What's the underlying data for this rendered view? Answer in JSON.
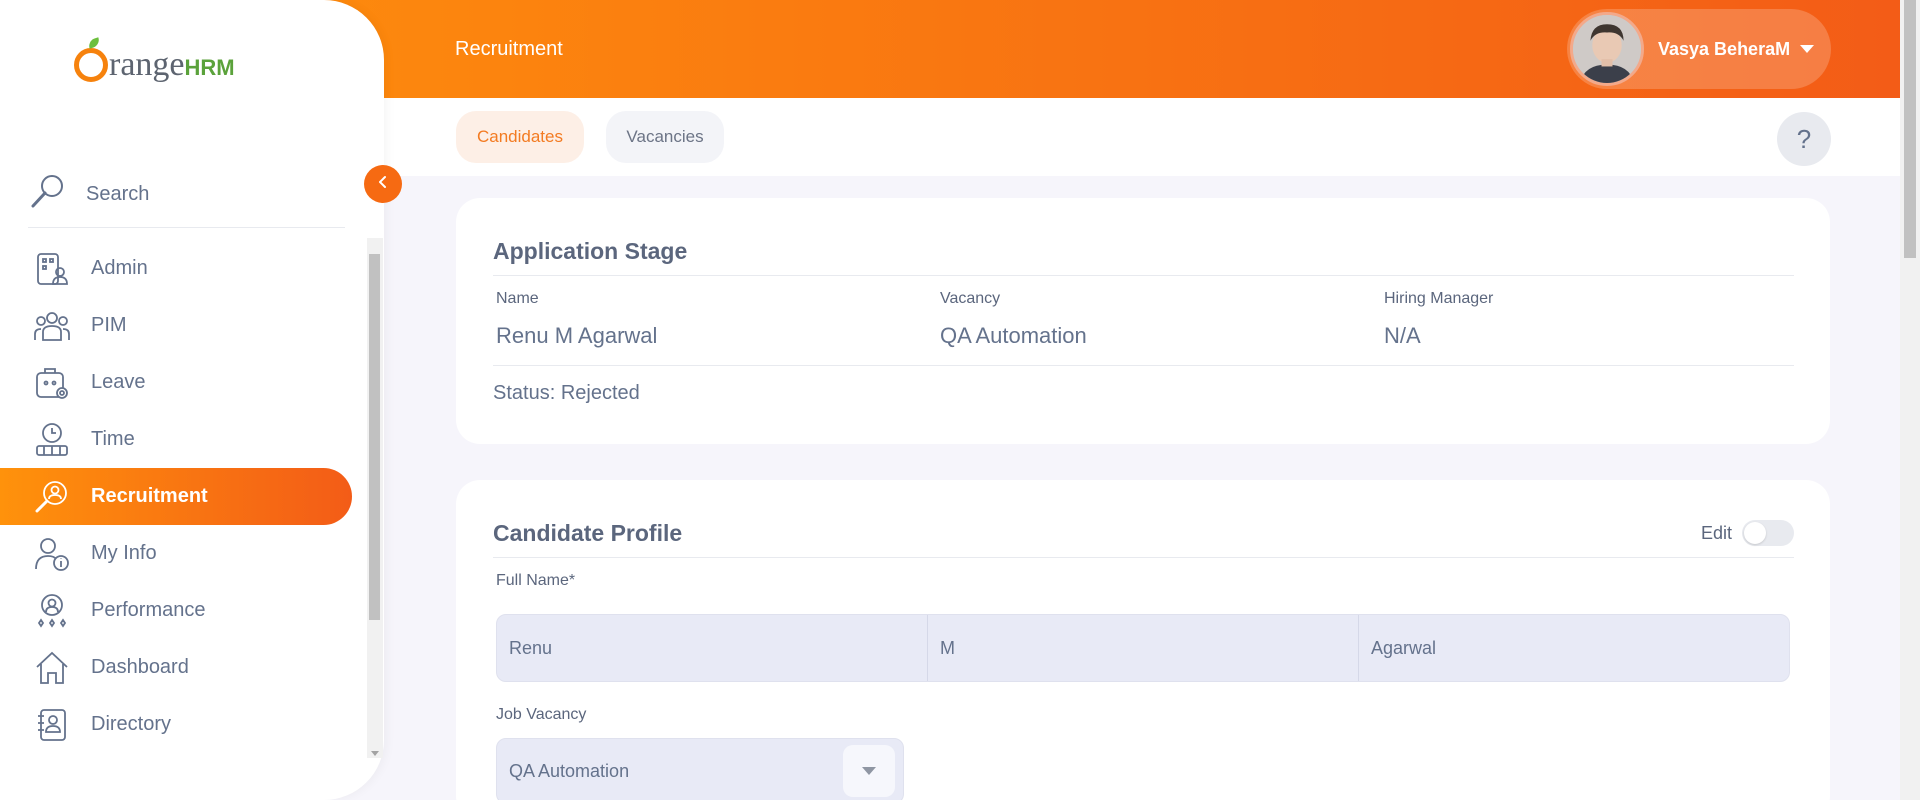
{
  "header": {
    "module_title": "Recruitment",
    "user_name": "Vasya BeheraM"
  },
  "tabs": [
    {
      "label": "Candidates",
      "active": true
    },
    {
      "label": "Vacancies",
      "active": false
    }
  ],
  "help": {
    "label": "?"
  },
  "sidebar": {
    "logo_prefix": "range",
    "logo_suffix": "HRM",
    "search_label": "Search",
    "items": [
      {
        "label": "Admin",
        "icon": "admin-icon"
      },
      {
        "label": "PIM",
        "icon": "pim-icon"
      },
      {
        "label": "Leave",
        "icon": "leave-icon"
      },
      {
        "label": "Time",
        "icon": "time-icon"
      },
      {
        "label": "Recruitment",
        "icon": "recruitment-icon",
        "active": true
      },
      {
        "label": "My Info",
        "icon": "my-info-icon"
      },
      {
        "label": "Performance",
        "icon": "performance-icon"
      },
      {
        "label": "Dashboard",
        "icon": "dashboard-icon"
      },
      {
        "label": "Directory",
        "icon": "directory-icon"
      }
    ]
  },
  "application_stage": {
    "title": "Application Stage",
    "name_label": "Name",
    "name_value": "Renu M Agarwal",
    "vacancy_label": "Vacancy",
    "vacancy_value": "QA Automation",
    "hiring_manager_label": "Hiring Manager",
    "hiring_manager_value": "N/A",
    "status_text": "Status: Rejected"
  },
  "candidate_profile": {
    "title": "Candidate Profile",
    "edit_label": "Edit",
    "edit_enabled": false,
    "full_name_label": "Full Name*",
    "first_name": "Renu",
    "middle_name": "M",
    "last_name": "Agarwal",
    "job_vacancy_label": "Job Vacancy",
    "job_vacancy_value": "QA Automation"
  },
  "colors": {
    "accent_start": "#ff920b",
    "accent_end": "#f35c17",
    "text": "#64728c"
  }
}
